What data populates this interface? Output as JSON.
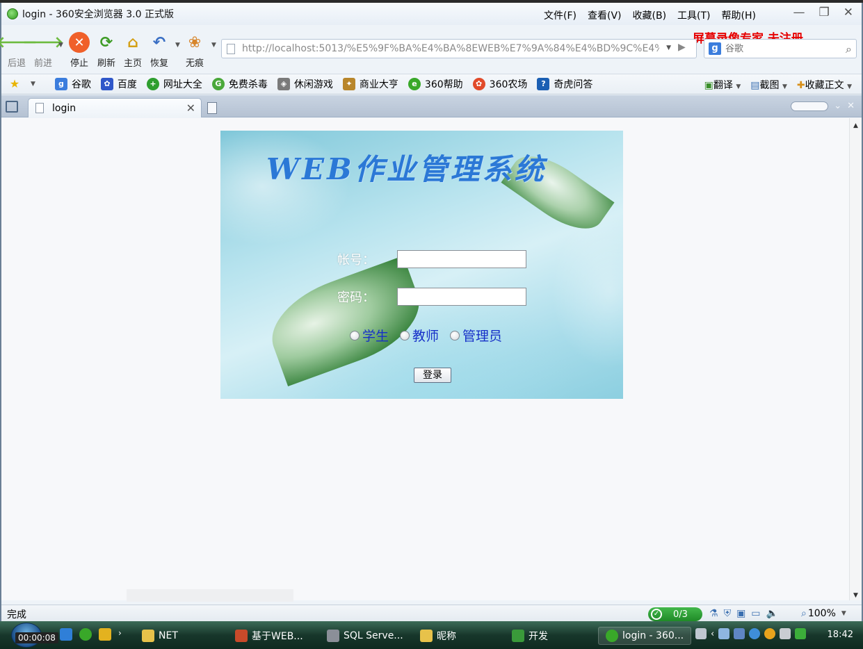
{
  "window": {
    "title": "login - 360安全浏览器 3.0 正式版",
    "menu": [
      "文件(F)",
      "查看(V)",
      "收藏(B)",
      "工具(T)",
      "帮助(H)"
    ],
    "recorder_notice": "屏幕录像专家  未注册"
  },
  "toolbar": {
    "back": "后退",
    "forward": "前进",
    "stop": "停止",
    "refresh": "刷新",
    "home": "主页",
    "restore": "恢复",
    "incognito": "无痕",
    "address": "http://localhost:5013/%E5%9F%BA%E4%BA%8EWEB%E7%9A%84%E4%BD%9C%E4%",
    "search_placeholder": "谷歌"
  },
  "bookmarks": {
    "items": [
      "谷歌",
      "百度",
      "网址大全",
      "免费杀毒",
      "休闲游戏",
      "商业大亨",
      "360帮助",
      "360农场",
      "奇虎问答"
    ],
    "right": [
      "翻译",
      "截图",
      "收藏正文"
    ]
  },
  "tabs": [
    {
      "label": "login"
    }
  ],
  "login": {
    "title": "WEB作业管理系统",
    "account_label": "帐号：",
    "password_label": "密码：",
    "roles": [
      "学生",
      "教师",
      "管理员"
    ],
    "submit": "登录"
  },
  "status": {
    "text": "完成",
    "security_count": "0/3",
    "zoom": "100%"
  },
  "taskbar": {
    "timer": "00:00:08",
    "tasks": [
      "NET",
      "基于WEB...",
      "SQL Serve...",
      "昵称",
      "开发",
      "login - 360..."
    ],
    "clock": "18:42"
  }
}
